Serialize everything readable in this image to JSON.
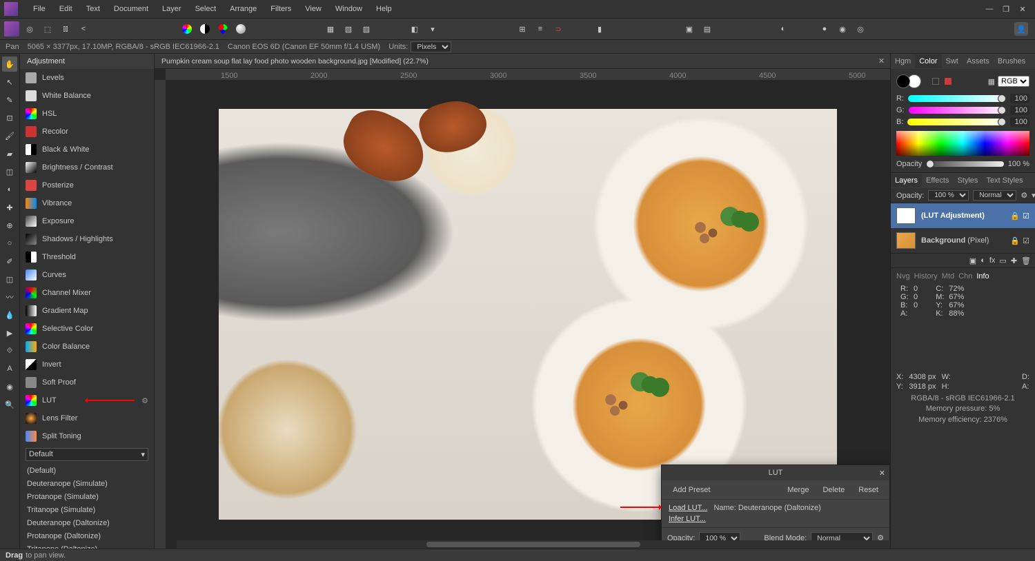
{
  "menubar": {
    "items": [
      "File",
      "Edit",
      "Text",
      "Document",
      "Layer",
      "Select",
      "Arrange",
      "Filters",
      "View",
      "Window",
      "Help"
    ]
  },
  "context": {
    "tool": "Pan",
    "dims": "5065 × 3377px, 17.10MP, RGBA/8 - sRGB IEC61966-2.1",
    "camera": "Canon EOS 6D (Canon EF 50mm f/1.4 USM)",
    "units_label": "Units:",
    "units_value": "Pixels"
  },
  "adjustment_panel": {
    "tab": "Adjustment",
    "items": [
      {
        "label": "Levels",
        "color": "#aaa"
      },
      {
        "label": "White Balance",
        "color": "#ddd"
      },
      {
        "label": "HSL",
        "color": "hue"
      },
      {
        "label": "Recolor",
        "color": "#c33"
      },
      {
        "label": "Black & White",
        "color": "bw"
      },
      {
        "label": "Brightness / Contrast",
        "color": "bc"
      },
      {
        "label": "Posterize",
        "color": "#d44"
      },
      {
        "label": "Vibrance",
        "color": "vib"
      },
      {
        "label": "Exposure",
        "color": "exp"
      },
      {
        "label": "Shadows / Highlights",
        "color": "sh"
      },
      {
        "label": "Threshold",
        "color": "th"
      },
      {
        "label": "Curves",
        "color": "cv"
      },
      {
        "label": "Channel Mixer",
        "color": "cm"
      },
      {
        "label": "Gradient Map",
        "color": "gm"
      },
      {
        "label": "Selective Color",
        "color": "sc"
      },
      {
        "label": "Color Balance",
        "color": "cb"
      },
      {
        "label": "Invert",
        "color": "inv"
      },
      {
        "label": "Soft Proof",
        "color": "sp"
      },
      {
        "label": "LUT",
        "color": "lut",
        "highlight": true
      },
      {
        "label": "Lens Filter",
        "color": "lf"
      },
      {
        "label": "Split Toning",
        "color": "st"
      }
    ],
    "preset_select": "Default",
    "presets": [
      "(Default)",
      "Deuteranope (Simulate)",
      "Protanope (Simulate)",
      "Tritanope (Simulate)",
      "Deuteranope (Daltonize)",
      "Protanope (Daltonize)",
      "Tritanope (Daltonize)"
    ]
  },
  "document": {
    "tab_title": "Pumpkin cream soup flat lay food photo wooden background.jpg [Modified] (22.7%)",
    "ruler_marks": [
      "1500",
      "2000",
      "2500",
      "3000",
      "3500",
      "4000",
      "4500",
      "5000"
    ]
  },
  "lut_dialog": {
    "title": "LUT",
    "add_preset": "Add Preset",
    "merge": "Merge",
    "delete": "Delete",
    "reset": "Reset",
    "load": "Load LUT...",
    "name_label": "Name:",
    "name_value": "Deuteranope (Daltonize)",
    "infer": "Infer LUT...",
    "opacity_label": "Opacity:",
    "opacity_value": "100 %",
    "blend_label": "Blend Mode:",
    "blend_value": "Normal"
  },
  "right": {
    "top_tabs": [
      "Hgm",
      "Color",
      "Swt",
      "Assets",
      "Brushes"
    ],
    "top_active": "Color",
    "color_mode": "RGB",
    "rgb": {
      "r": 100,
      "g": 100,
      "b": 100
    },
    "opacity_label": "Opacity",
    "opacity_value": "100 %",
    "layer_tabs": [
      "Layers",
      "Effects",
      "Styles",
      "Text Styles"
    ],
    "layer_active": "Layers",
    "layers_head": {
      "opacity_label": "Opacity:",
      "opacity_value": "100 %",
      "blend": "Normal"
    },
    "layers": [
      {
        "name": "(LUT Adjustment)",
        "selected": true
      },
      {
        "name": "Background",
        "suffix": "(Pixel)",
        "selected": false
      }
    ],
    "info_tabs": [
      "Nvg",
      "History",
      "Mtd",
      "Chn",
      "Info"
    ],
    "info_active": "Info",
    "info_left": [
      [
        "R:",
        "0"
      ],
      [
        "G:",
        "0"
      ],
      [
        "B:",
        "0"
      ],
      [
        "A:",
        ""
      ]
    ],
    "info_right": [
      [
        "C:",
        "72%"
      ],
      [
        "M:",
        "67%"
      ],
      [
        "Y:",
        "67%"
      ],
      [
        "K:",
        "88%"
      ]
    ],
    "coords": {
      "x_label": "X:",
      "x_val": "4308 px",
      "y_label": "Y:",
      "y_val": "3918 px",
      "w_label": "W:",
      "h_label": "H:",
      "d_label": "D:",
      "a_label": "A:"
    },
    "status": [
      "RGBA/8 - sRGB IEC61966-2.1",
      "Memory pressure: 5%",
      "Memory efficiency: 2376%"
    ]
  },
  "statusbar": {
    "hint_bold": "Drag",
    "hint_rest": "to pan view."
  }
}
